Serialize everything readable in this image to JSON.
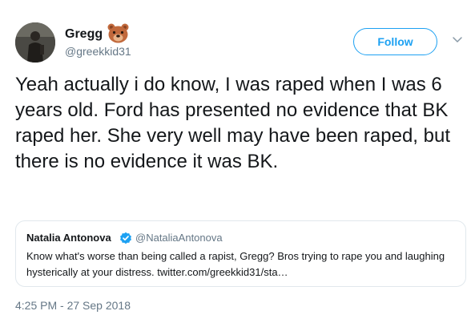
{
  "author": {
    "name": "Gregg",
    "handle": "@greekkid31",
    "name_emoji_icon": "bear-face-icon"
  },
  "follow_button": {
    "label": "Follow"
  },
  "menu_icon": "chevron-down-icon",
  "tweet_text": "Yeah actually i do know, I was raped when I was 6 years old. Ford has presented no evidence that BK raped her. She very well may have been raped, but there is no evidence it was BK.",
  "quoted_tweet": {
    "name": "Natalia Antonova",
    "verified_icon": "verified-badge-icon",
    "handle": "@NataliaAntonova",
    "text": "Know what's worse than being called a rapist, Gregg? Bros trying to rape you and laughing hysterically at your distress. twitter.com/greekkid31/sta…"
  },
  "timestamp": "4:25 PM - 27 Sep 2018",
  "colors": {
    "accent": "#1da1f2",
    "text": "#14171a",
    "muted": "#657786",
    "border": "#e1e8ed"
  }
}
